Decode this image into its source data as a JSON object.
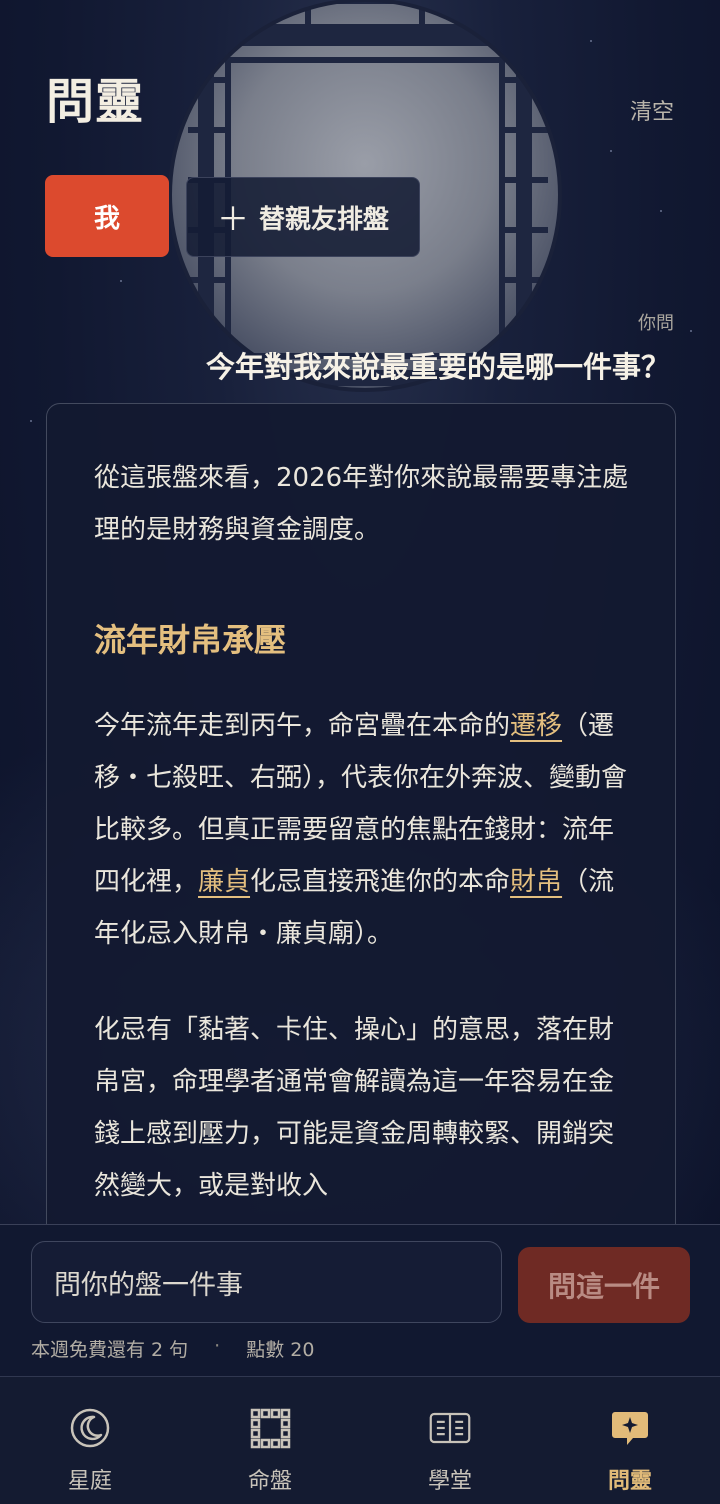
{
  "header": {
    "title": "問靈",
    "clear_label": "清空"
  },
  "profiles": {
    "me_label": "我",
    "add_label": "替親友排盤",
    "add_icon": "plus-icon"
  },
  "question": {
    "label": "你問",
    "text": "今年對我來說最重要的是哪一件事？"
  },
  "answer": {
    "intro": "從這張盤來看，2026年對你來說最需要專注處理的是財務與資金調度。",
    "section_title": "流年財帛承壓",
    "p1_a": "今年流年走到丙午，命宮疊在本命的",
    "p1_link1": "遷移",
    "p1_b": "（遷移・七殺旺、右弼），代表你在外奔波、變動會比較多。但真正需要留意的焦點在錢財：流年四化裡，",
    "p1_link2": "廉貞",
    "p1_c": "化忌直接飛進你的本命",
    "p1_link3": "財帛",
    "p1_d": "（流年化忌入財帛・廉貞廟）。",
    "p2": "化忌有「黏著、卡住、操心」的意思，落在財帛宮，命理學者通常會解讀為這一年容易在金錢上感到壓力，可能是資金周轉較緊、開銷突然變大，或是對收入"
  },
  "composer": {
    "placeholder": "問你的盤一件事",
    "send_label": "問這一件",
    "quota_text": "本週免費還有 2 句",
    "separator": "·",
    "points_text": "點數 20"
  },
  "nav": {
    "items": [
      {
        "label": "星庭",
        "icon": "moon-icon"
      },
      {
        "label": "命盤",
        "icon": "chart-grid-icon"
      },
      {
        "label": "學堂",
        "icon": "book-icon"
      },
      {
        "label": "問靈",
        "icon": "chat-spark-icon",
        "active": true
      }
    ]
  },
  "colors": {
    "accent_red": "#dc4a2e",
    "gold": "#e4bf7f",
    "background": "#0f1730",
    "send_disabled": "#6f2a24"
  }
}
